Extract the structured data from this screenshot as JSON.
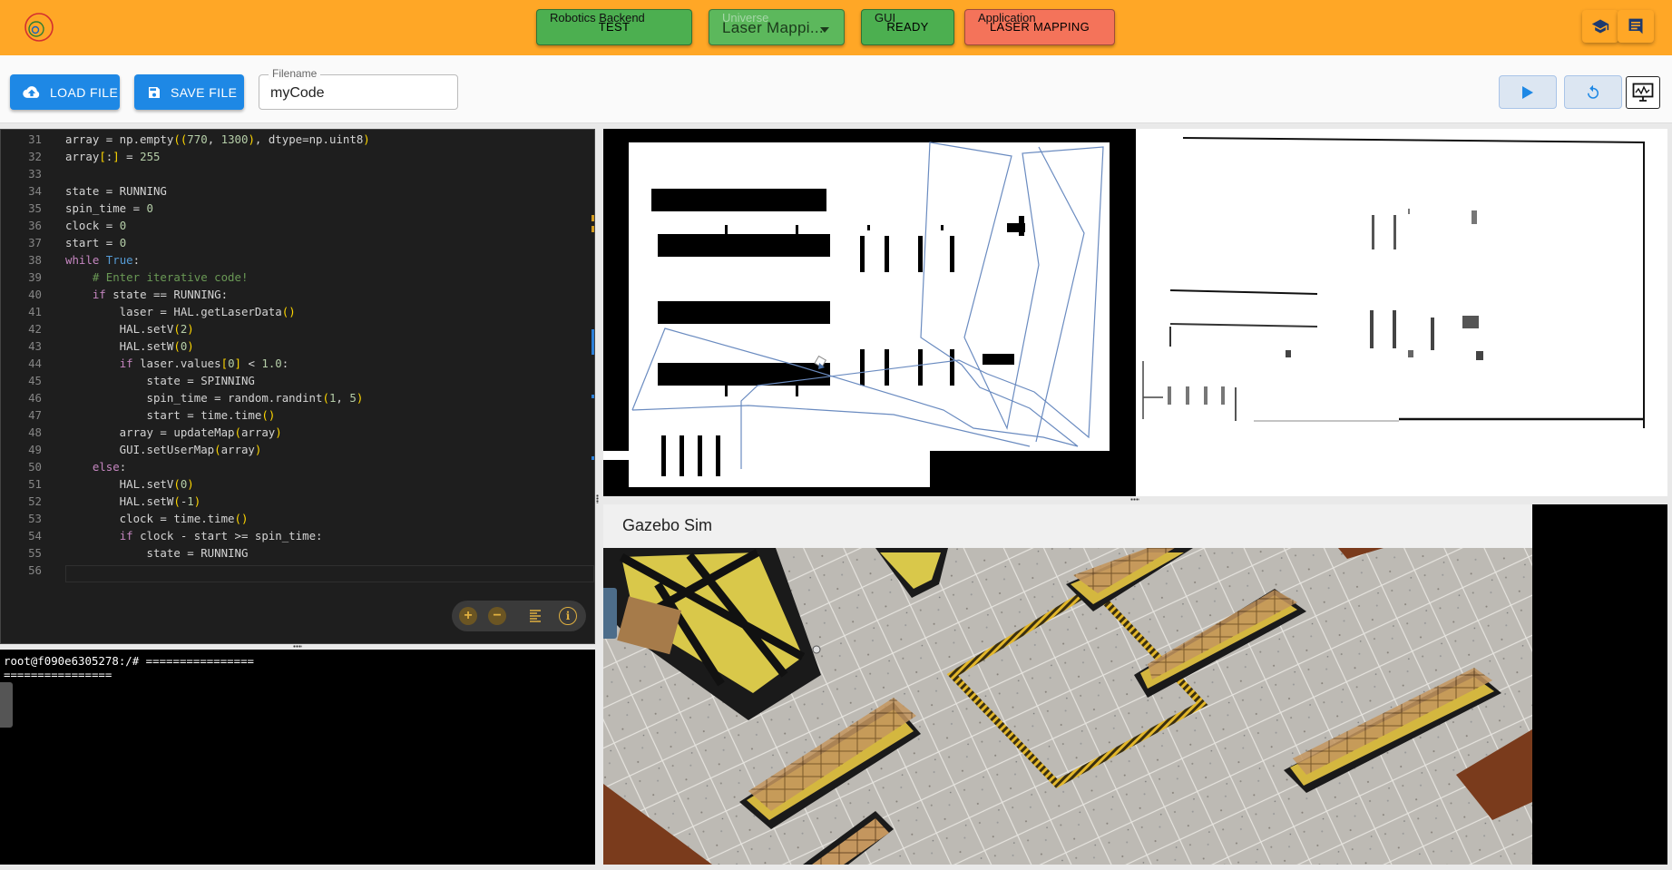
{
  "header": {
    "backend": {
      "label": "Robotics Backend",
      "value": "TEST"
    },
    "universe": {
      "label": "Universe",
      "value": "Laser Mappi..."
    },
    "gui": {
      "label": "GUI",
      "value": "READY"
    },
    "application": {
      "label": "Application",
      "value": "LASER MAPPING"
    },
    "icons": [
      "school-icon",
      "comment-icon"
    ]
  },
  "toolbar": {
    "load_label": "LOAD FILE",
    "save_label": "SAVE FILE",
    "filename_label": "Filename",
    "filename_value": "myCode",
    "icons": [
      "play-icon",
      "reset-icon",
      "monitor-icon"
    ]
  },
  "editor": {
    "lines": [
      {
        "n": "31",
        "code": "array = np.empty((770, 1300), dtype=np.uint8)"
      },
      {
        "n": "32",
        "code": "array[:] = 255"
      },
      {
        "n": "33",
        "code": ""
      },
      {
        "n": "34",
        "code": "state = RUNNING"
      },
      {
        "n": "35",
        "code": "spin_time = 0"
      },
      {
        "n": "36",
        "code": "clock = 0"
      },
      {
        "n": "37",
        "code": "start = 0"
      },
      {
        "n": "38",
        "code": "while True:"
      },
      {
        "n": "39",
        "code": "    # Enter iterative code!"
      },
      {
        "n": "40",
        "code": "    if state == RUNNING:"
      },
      {
        "n": "41",
        "code": "        laser = HAL.getLaserData()"
      },
      {
        "n": "42",
        "code": "        HAL.setV(2)"
      },
      {
        "n": "43",
        "code": "        HAL.setW(0)"
      },
      {
        "n": "44",
        "code": "        if laser.values[0] < 1.0:"
      },
      {
        "n": "45",
        "code": "            state = SPINNING"
      },
      {
        "n": "46",
        "code": "            spin_time = random.randint(1, 5)"
      },
      {
        "n": "47",
        "code": "            start = time.time()"
      },
      {
        "n": "48",
        "code": "        array = updateMap(array)"
      },
      {
        "n": "49",
        "code": "        GUI.setUserMap(array)"
      },
      {
        "n": "50",
        "code": "    else:"
      },
      {
        "n": "51",
        "code": "        HAL.setV(0)"
      },
      {
        "n": "52",
        "code": "        HAL.setW(-1)"
      },
      {
        "n": "53",
        "code": "        clock = time.time()"
      },
      {
        "n": "54",
        "code": "        if clock - start >= spin_time:"
      },
      {
        "n": "55",
        "code": "            state = RUNNING"
      },
      {
        "n": "56",
        "code": ""
      }
    ],
    "tools": [
      "zoom-in-icon",
      "zoom-out-icon",
      "format-icon",
      "info-icon"
    ]
  },
  "terminal": {
    "text": "root@f090e6305278:/# ================\n================"
  },
  "gazebo": {
    "title": "Gazebo Sim"
  },
  "colors": {
    "header": "#ffa726",
    "green": "#4caf50",
    "red": "#f4735a",
    "accent": "#1e88e5"
  }
}
